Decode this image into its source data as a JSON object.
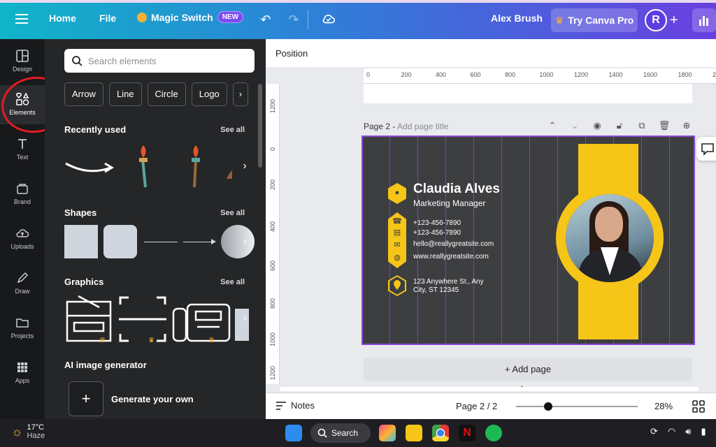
{
  "topbar": {
    "home": "Home",
    "file": "File",
    "magic_switch": "Magic Switch",
    "new_badge": "NEW",
    "font_name": "Alex Brush",
    "try_pro": "Try Canva Pro",
    "avatar_letter": "R"
  },
  "rail": {
    "items": [
      {
        "label": "Design",
        "icon": "design-icon"
      },
      {
        "label": "Elements",
        "icon": "elements-icon"
      },
      {
        "label": "Text",
        "icon": "text-icon"
      },
      {
        "label": "Brand",
        "icon": "brand-icon"
      },
      {
        "label": "Uploads",
        "icon": "uploads-icon"
      },
      {
        "label": "Draw",
        "icon": "draw-icon"
      },
      {
        "label": "Projects",
        "icon": "projects-icon"
      },
      {
        "label": "Apps",
        "icon": "apps-icon"
      }
    ]
  },
  "panel": {
    "search_placeholder": "Search elements",
    "chips": [
      "Arrow",
      "Line",
      "Circle",
      "Logo"
    ],
    "recently_used": "Recently used",
    "shapes": "Shapes",
    "graphics": "Graphics",
    "see_all": "See all",
    "ai_generator": "AI image generator",
    "generate": "Generate your own"
  },
  "work": {
    "position": "Position",
    "ruler_top": [
      "0",
      "200",
      "400",
      "600",
      "800",
      "1000",
      "1200",
      "1400",
      "1600",
      "1800",
      "2"
    ],
    "ruler_left": [
      "1200",
      "0",
      "200",
      "400",
      "600",
      "800",
      "1000",
      "1200"
    ],
    "page_label": "Page 2 - ",
    "page_title_placeholder": "Add page title",
    "add_page": "+ Add page",
    "notes": "Notes",
    "page_count": "Page 2 / 2",
    "zoom": "28%",
    "zoom_level": 0.28
  },
  "card": {
    "name": "Claudia Alves",
    "role": "Marketing Manager",
    "phone1": "+123-456-7890",
    "phone2": "+123-456-7890",
    "email": "hello@reallygreatsite.com",
    "website": "www.reallygreatsite.com",
    "address1": "123 Anywhere St., Any",
    "address2": "City, ST 12345",
    "accent": "#f5c518",
    "background": "#3d3e40"
  },
  "taskbar": {
    "temp": "17°C",
    "condition": "Haze",
    "search": "Search"
  }
}
